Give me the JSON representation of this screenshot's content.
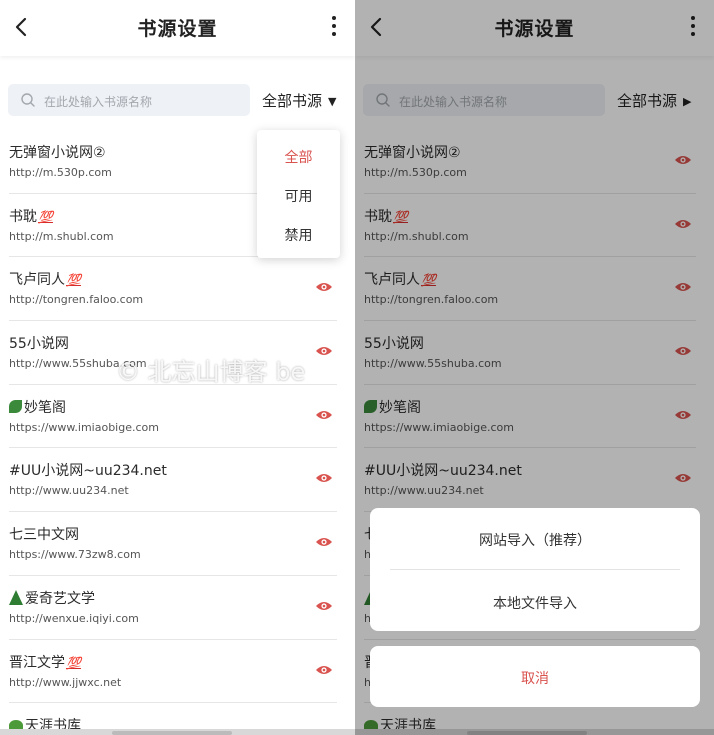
{
  "app": {
    "title": "书源设置"
  },
  "search": {
    "placeholder": "在此处输入书源名称"
  },
  "filter": {
    "left_label": "全部书源",
    "right_label": "全部书源"
  },
  "dropdown": {
    "options": [
      "全部",
      "可用",
      "禁用"
    ],
    "selected": "全部"
  },
  "sources": [
    {
      "name": "无弹窗小说网②",
      "url": "http://m.530p.com",
      "icon": ""
    },
    {
      "name": "书耽",
      "url": "http://m.shubl.com",
      "icon": "hundred-points"
    },
    {
      "name": "飞卢同人",
      "url": "http://tongren.faloo.com",
      "icon": "hundred-points"
    },
    {
      "name": "55小说网",
      "url": "http://www.55shuba.com",
      "icon": ""
    },
    {
      "name": "妙笔阁",
      "url": "https://www.imiaobige.com",
      "icon": "four-leaf-clover"
    },
    {
      "name": "#UU小说网~uu234.net",
      "url": "http://www.uu234.net",
      "icon": ""
    },
    {
      "name": "七三中文网",
      "url": "https://www.73zw8.com",
      "icon": ""
    },
    {
      "name": "爱奇艺文学",
      "url": "http://wenxue.iqiyi.com",
      "icon": "evergreen-tree"
    },
    {
      "name": "晋江文学",
      "url": "http://www.jjwxc.net",
      "icon": "hundred-points"
    },
    {
      "name": "天涯书库",
      "url": "",
      "icon": "palm-tree"
    }
  ],
  "hundred_glyph": "💯",
  "import_sheet": {
    "website_import": "网站导入（推荐）",
    "local_import": "本地文件导入",
    "cancel": "取消"
  },
  "watermark": "© 北忘山博客 be",
  "colors": {
    "accent": "#d9534f",
    "eye": "#d9534f",
    "search_bg": "#eef1f5"
  }
}
